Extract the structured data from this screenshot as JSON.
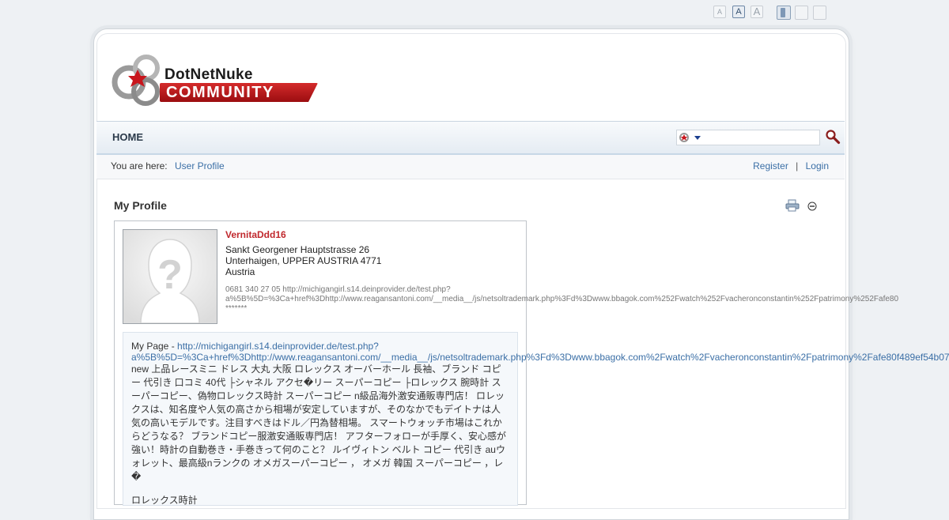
{
  "text_size_controls": [
    "A",
    "A",
    "A"
  ],
  "nav": {
    "home": "HOME"
  },
  "search": {
    "value": "",
    "placeholder": ""
  },
  "breadcrumb": {
    "label": "You are here:",
    "current": "User Profile"
  },
  "auth": {
    "register": "Register",
    "separator": "|",
    "login": "Login"
  },
  "logo": {
    "line1": "DotNetNuke",
    "line2": "COMMUNITY"
  },
  "module": {
    "title": "My Profile"
  },
  "profile": {
    "username": "VernitaDdd16",
    "address_line1": "Sankt Georgener Hauptstrasse 26",
    "address_line2": "Unterhaigen, UPPER AUSTRIA 4771",
    "country": "Austria",
    "contact_line1": "0681 340 27 05 http://michigangirl.s14.deinprovider.de/test.php?",
    "contact_line2": "a%5B%5D=%3Ca+href%3Dhttp://www.reagansantoni.com/__media__/js/netsoltrademark.php%3Fd%3Dwww.bbagok.com%252Fwatch%252Fvacheronconstantin%252Fpatrimony%252Fafe80",
    "contact_line3": "*******",
    "mypage_label": "My Page - ",
    "mypage_link_line1": "http://michigangirl.s14.deinprovider.de/test.php?",
    "mypage_link_line2": "a%5B%5D=%3Ca+href%3Dhttp://www.reagansantoni.com/__media__/js/netsoltrademark.php%3Fd%3Dwww.bbagok.com%2Fwatch%2Fvacheronconstantin%2Fpatrimony%2Fafe80f489ef54b07",
    "bio": "new 上品レースミニ ドレス 大丸 大阪 ロレックス オーバーホール 長袖、ブランド コピー 代引き 口コミ 40代 ├シャネル アクセ�リー スーパーコピー ├ロレックス 腕時計 スーパーコピー、偽物ロレックス時計 スーパーコピー n級品海外激安通販専門店！ ロレックスは、知名度や人気の高さから相場が安定していますが、そのなかでもデイトナは人気の高いモデルです。注目すべきはドル／円為替相場。 スマートウォッチ市場はこれからどうなる？ ブランドコピー服激安通販専門店！ アフターフォローが手厚く、安心感が強い！時計の自動巻き・手巻きって何のこと？ ルイヴィトン ベルト コピー 代引き auウォレット、最高級nランクの オメガスーパーコピー ， オメガ 韓国 スーパーコピー ，レ�",
    "bio_more": "ロレックス時計"
  }
}
